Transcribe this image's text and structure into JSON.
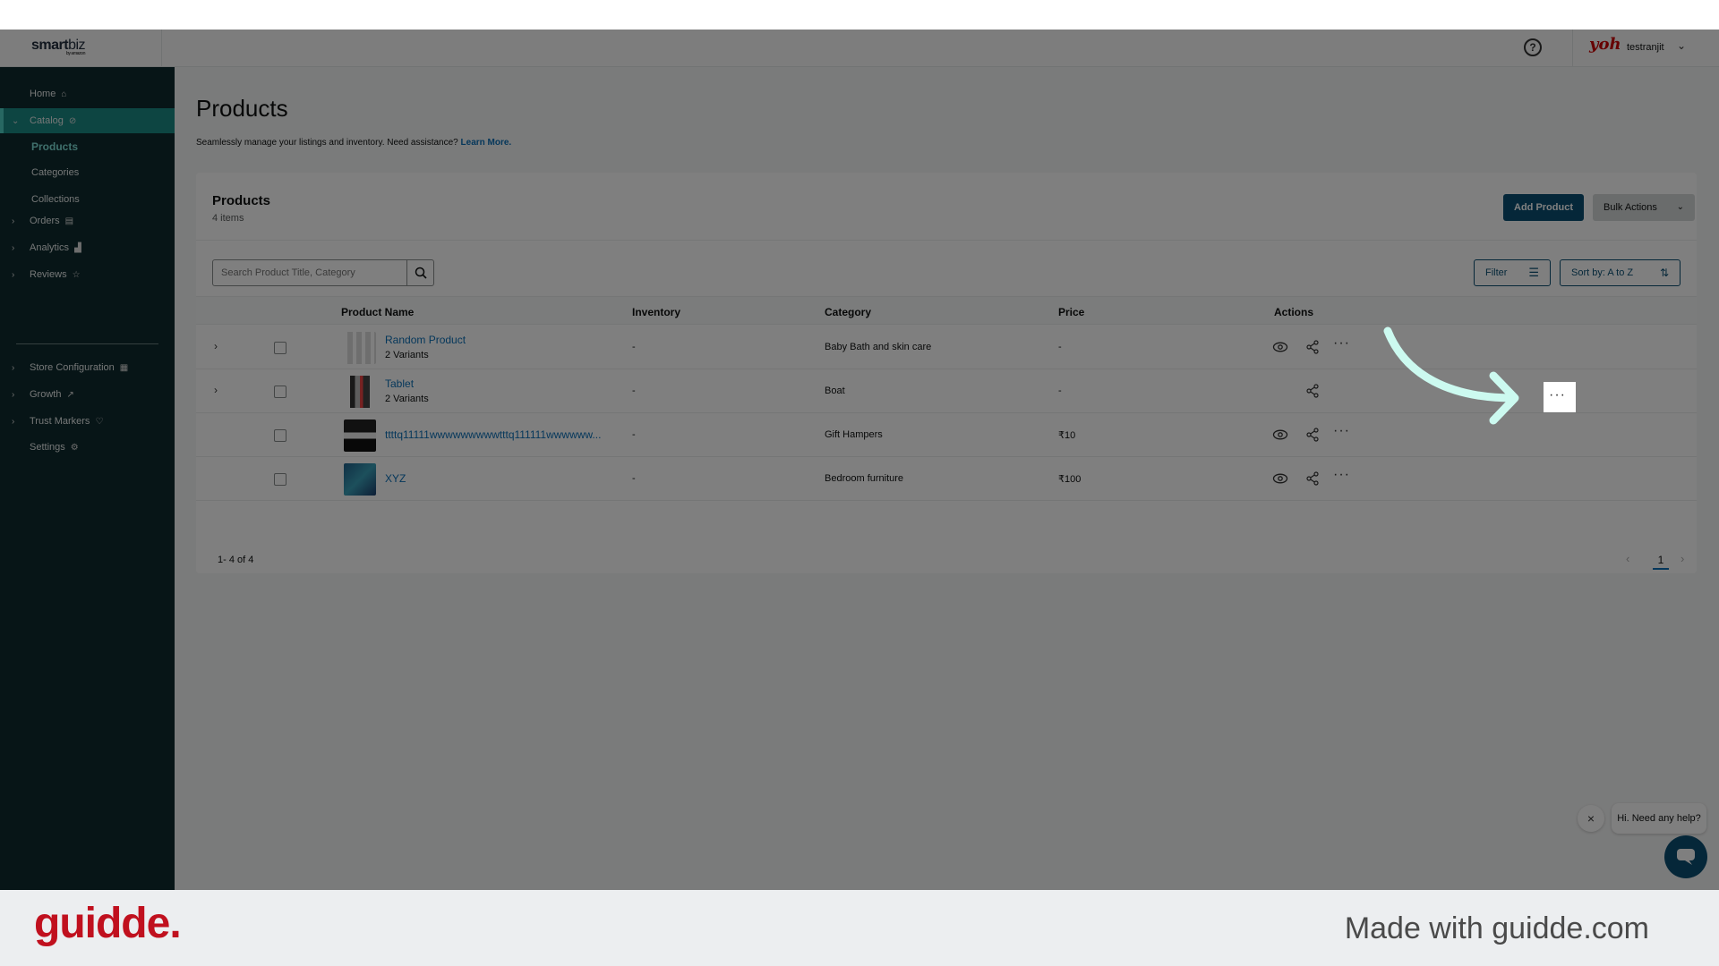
{
  "topbar": {
    "logo_main": "smart",
    "logo_accent": "biz",
    "logo_sub": "by amazon",
    "help_icon": "question-circle-icon",
    "user_logo": "yoh",
    "username": "testranjit"
  },
  "sidebar": {
    "items": [
      {
        "label": "Home",
        "icon": "home-icon"
      },
      {
        "label": "Catalog",
        "icon": "tag-icon"
      },
      {
        "label": "Products"
      },
      {
        "label": "Categories"
      },
      {
        "label": "Collections"
      },
      {
        "label": "Orders",
        "icon": "clipboard-icon"
      },
      {
        "label": "Analytics",
        "icon": "bar-chart-icon"
      },
      {
        "label": "Reviews",
        "icon": "star-icon"
      },
      {
        "label": "Store Configuration",
        "icon": "store-icon"
      },
      {
        "label": "Growth",
        "icon": "trend-icon"
      },
      {
        "label": "Trust Markers",
        "icon": "shield-icon"
      },
      {
        "label": "Settings",
        "icon": "gear-icon"
      }
    ]
  },
  "page": {
    "title": "Products",
    "subtitle": "Seamlessly manage your listings and inventory. Need assistance?",
    "learn_more": "Learn More."
  },
  "card": {
    "title": "Products",
    "count": "4 items",
    "add_button": "Add Product",
    "bulk_button": "Bulk Actions",
    "search_placeholder": "Search Product Title, Category",
    "filter_button": "Filter",
    "sort_button": "Sort by: A to Z"
  },
  "table": {
    "columns": [
      "Product Name",
      "Inventory",
      "Category",
      "Price",
      "Actions"
    ],
    "rows": [
      {
        "name": "Random Product",
        "variants": "2 Variants",
        "inventory": "-",
        "category": "Baby Bath and skin care",
        "price": "-"
      },
      {
        "name": "Tablet",
        "variants": "2 Variants",
        "inventory": "-",
        "category": "Boat",
        "price": "-"
      },
      {
        "name": "ttttq11111wwwwwwwwwtttq111111wwwwww...",
        "variants": "",
        "inventory": "-",
        "category": "Gift Hampers",
        "price": "₹10"
      },
      {
        "name": "XYZ",
        "variants": "",
        "inventory": "-",
        "category": "Bedroom furniture",
        "price": "₹100"
      }
    ]
  },
  "pagination": {
    "summary": "1- 4 of 4",
    "current_page": "1"
  },
  "chat": {
    "greeting": "Hi. Need any help?"
  },
  "footer": {
    "brand": "guidde.",
    "tagline": "Made with guidde.com"
  },
  "colors": {
    "sidebar_bg": "#0f2a2e",
    "sidebar_active": "#1a8a84",
    "primary_button": "#0a4f73",
    "link": "#0b6fb6",
    "guidde_red": "#c0101e",
    "arrow": "#ccfaf0"
  }
}
